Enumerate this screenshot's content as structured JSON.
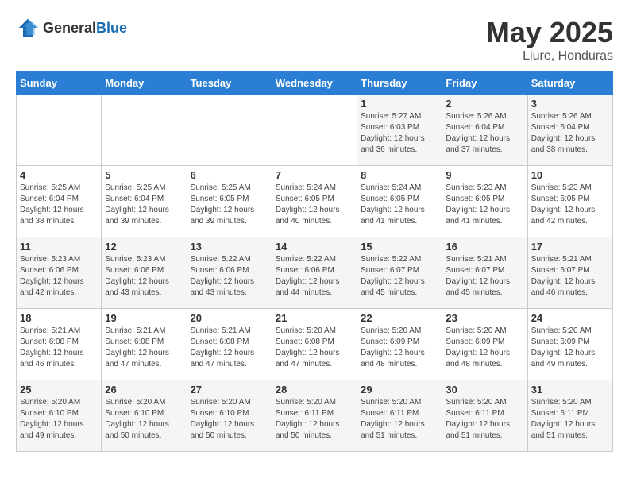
{
  "header": {
    "logo": {
      "text_general": "General",
      "text_blue": "Blue"
    },
    "month": "May 2025",
    "location": "Liure, Honduras"
  },
  "weekdays": [
    "Sunday",
    "Monday",
    "Tuesday",
    "Wednesday",
    "Thursday",
    "Friday",
    "Saturday"
  ],
  "weeks": [
    [
      {
        "day": "",
        "content": ""
      },
      {
        "day": "",
        "content": ""
      },
      {
        "day": "",
        "content": ""
      },
      {
        "day": "",
        "content": ""
      },
      {
        "day": "1",
        "content": "Sunrise: 5:27 AM\nSunset: 6:03 PM\nDaylight: 12 hours\nand 36 minutes."
      },
      {
        "day": "2",
        "content": "Sunrise: 5:26 AM\nSunset: 6:04 PM\nDaylight: 12 hours\nand 37 minutes."
      },
      {
        "day": "3",
        "content": "Sunrise: 5:26 AM\nSunset: 6:04 PM\nDaylight: 12 hours\nand 38 minutes."
      }
    ],
    [
      {
        "day": "4",
        "content": "Sunrise: 5:25 AM\nSunset: 6:04 PM\nDaylight: 12 hours\nand 38 minutes."
      },
      {
        "day": "5",
        "content": "Sunrise: 5:25 AM\nSunset: 6:04 PM\nDaylight: 12 hours\nand 39 minutes."
      },
      {
        "day": "6",
        "content": "Sunrise: 5:25 AM\nSunset: 6:05 PM\nDaylight: 12 hours\nand 39 minutes."
      },
      {
        "day": "7",
        "content": "Sunrise: 5:24 AM\nSunset: 6:05 PM\nDaylight: 12 hours\nand 40 minutes."
      },
      {
        "day": "8",
        "content": "Sunrise: 5:24 AM\nSunset: 6:05 PM\nDaylight: 12 hours\nand 41 minutes."
      },
      {
        "day": "9",
        "content": "Sunrise: 5:23 AM\nSunset: 6:05 PM\nDaylight: 12 hours\nand 41 minutes."
      },
      {
        "day": "10",
        "content": "Sunrise: 5:23 AM\nSunset: 6:05 PM\nDaylight: 12 hours\nand 42 minutes."
      }
    ],
    [
      {
        "day": "11",
        "content": "Sunrise: 5:23 AM\nSunset: 6:06 PM\nDaylight: 12 hours\nand 42 minutes."
      },
      {
        "day": "12",
        "content": "Sunrise: 5:23 AM\nSunset: 6:06 PM\nDaylight: 12 hours\nand 43 minutes."
      },
      {
        "day": "13",
        "content": "Sunrise: 5:22 AM\nSunset: 6:06 PM\nDaylight: 12 hours\nand 43 minutes."
      },
      {
        "day": "14",
        "content": "Sunrise: 5:22 AM\nSunset: 6:06 PM\nDaylight: 12 hours\nand 44 minutes."
      },
      {
        "day": "15",
        "content": "Sunrise: 5:22 AM\nSunset: 6:07 PM\nDaylight: 12 hours\nand 45 minutes."
      },
      {
        "day": "16",
        "content": "Sunrise: 5:21 AM\nSunset: 6:07 PM\nDaylight: 12 hours\nand 45 minutes."
      },
      {
        "day": "17",
        "content": "Sunrise: 5:21 AM\nSunset: 6:07 PM\nDaylight: 12 hours\nand 46 minutes."
      }
    ],
    [
      {
        "day": "18",
        "content": "Sunrise: 5:21 AM\nSunset: 6:08 PM\nDaylight: 12 hours\nand 46 minutes."
      },
      {
        "day": "19",
        "content": "Sunrise: 5:21 AM\nSunset: 6:08 PM\nDaylight: 12 hours\nand 47 minutes."
      },
      {
        "day": "20",
        "content": "Sunrise: 5:21 AM\nSunset: 6:08 PM\nDaylight: 12 hours\nand 47 minutes."
      },
      {
        "day": "21",
        "content": "Sunrise: 5:20 AM\nSunset: 6:08 PM\nDaylight: 12 hours\nand 47 minutes."
      },
      {
        "day": "22",
        "content": "Sunrise: 5:20 AM\nSunset: 6:09 PM\nDaylight: 12 hours\nand 48 minutes."
      },
      {
        "day": "23",
        "content": "Sunrise: 5:20 AM\nSunset: 6:09 PM\nDaylight: 12 hours\nand 48 minutes."
      },
      {
        "day": "24",
        "content": "Sunrise: 5:20 AM\nSunset: 6:09 PM\nDaylight: 12 hours\nand 49 minutes."
      }
    ],
    [
      {
        "day": "25",
        "content": "Sunrise: 5:20 AM\nSunset: 6:10 PM\nDaylight: 12 hours\nand 49 minutes."
      },
      {
        "day": "26",
        "content": "Sunrise: 5:20 AM\nSunset: 6:10 PM\nDaylight: 12 hours\nand 50 minutes."
      },
      {
        "day": "27",
        "content": "Sunrise: 5:20 AM\nSunset: 6:10 PM\nDaylight: 12 hours\nand 50 minutes."
      },
      {
        "day": "28",
        "content": "Sunrise: 5:20 AM\nSunset: 6:11 PM\nDaylight: 12 hours\nand 50 minutes."
      },
      {
        "day": "29",
        "content": "Sunrise: 5:20 AM\nSunset: 6:11 PM\nDaylight: 12 hours\nand 51 minutes."
      },
      {
        "day": "30",
        "content": "Sunrise: 5:20 AM\nSunset: 6:11 PM\nDaylight: 12 hours\nand 51 minutes."
      },
      {
        "day": "31",
        "content": "Sunrise: 5:20 AM\nSunset: 6:11 PM\nDaylight: 12 hours\nand 51 minutes."
      }
    ]
  ]
}
